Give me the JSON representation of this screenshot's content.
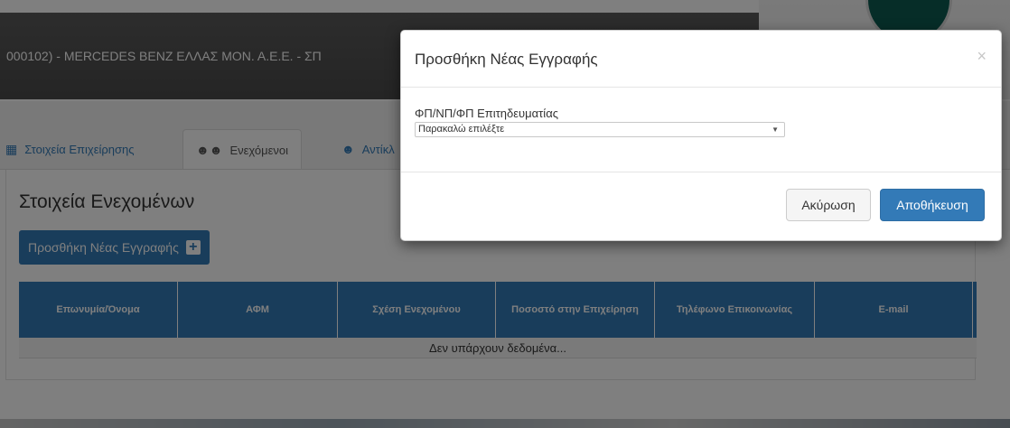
{
  "header": {
    "title": "000102) - MERCEDES BENZ ΕΛΛΑΣ ΜΟΝ. Α.Ε.Ε. - ΣΠ"
  },
  "tabs": [
    {
      "label": "Στοιχεία Επιχείρησης",
      "icon": "table-icon"
    },
    {
      "label": "Ενεχόμενοι",
      "icon": "users-icon"
    },
    {
      "label": "Αντίκλ",
      "icon": "user-icon"
    }
  ],
  "main": {
    "section_title": "Στοιχεία Ενεχομένων",
    "add_button_label": "Προσθήκη Νέας Εγγραφής",
    "table": {
      "headers": [
        "Επωνυμία/Όνομα",
        "ΑΦΜ",
        "Σχέση Ενεχομένου",
        "Ποσοστό στην Επιχείρηση",
        "Τηλέφωνο Επικοινωνίας",
        "E-mail"
      ],
      "empty_message": "Δεν υπάρχουν δεδομένα..."
    }
  },
  "modal": {
    "title": "Προσθήκη Νέας Εγγραφής",
    "close_symbol": "×",
    "field_label": "ΦΠ/ΝΠ/ΦΠ Επιτηδευματίας",
    "select_value": "Παρακαλώ επιλέξτε",
    "cancel_label": "Ακύρωση",
    "save_label": "Αποθήκευση"
  },
  "colors": {
    "primary": "#337ab7",
    "header_bg": "#555555",
    "logo": "#0d5b50"
  }
}
